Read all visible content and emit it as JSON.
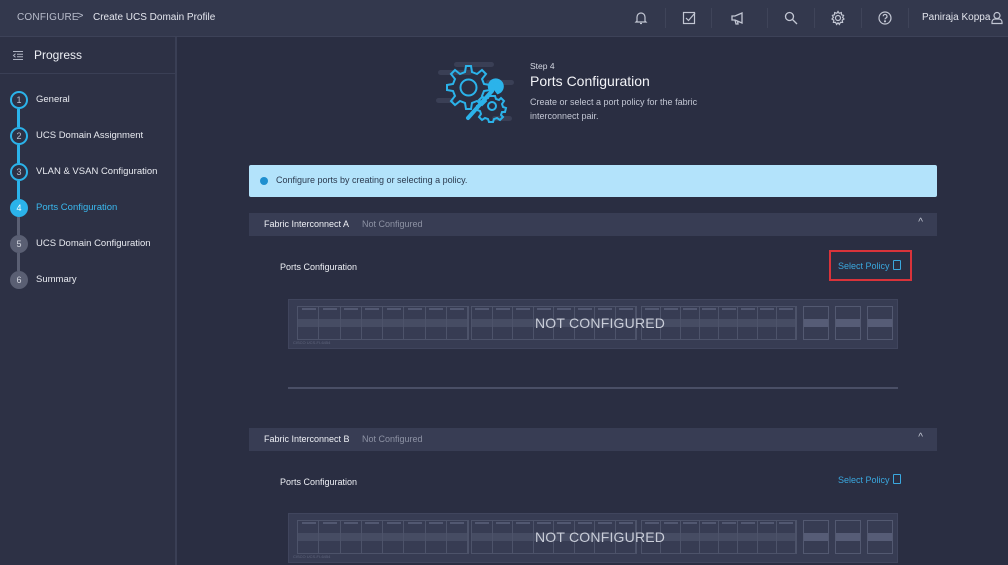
{
  "topbar": {
    "breadcrumb_root": "CONFIGURE",
    "breadcrumb_separator": ">",
    "breadcrumb_page": "Create UCS Domain Profile",
    "icons": [
      "bell-icon",
      "task-checklist-icon",
      "megaphone-icon",
      "search-icon",
      "gear-icon",
      "help-icon",
      "user-icon"
    ],
    "user_name": "Paniraja Koppa"
  },
  "sidebar": {
    "title": "Progress",
    "steps": [
      {
        "number": "1",
        "label": "General",
        "state": "done"
      },
      {
        "number": "2",
        "label": "UCS Domain Assignment",
        "state": "done"
      },
      {
        "number": "3",
        "label": "VLAN & VSAN Configuration",
        "state": "done"
      },
      {
        "number": "4",
        "label": "Ports Configuration",
        "state": "active"
      },
      {
        "number": "5",
        "label": "UCS Domain Configuration",
        "state": "pending"
      },
      {
        "number": "6",
        "label": "Summary",
        "state": "pending"
      }
    ]
  },
  "hero": {
    "step": "Step 4",
    "title": "Ports Configuration",
    "description": "Create or select a port policy for the fabric interconnect pair."
  },
  "info_banner": {
    "text": "Configure ports by creating or selecting a policy."
  },
  "fabric_interconnects": [
    {
      "name": "Fabric Interconnect A",
      "status": "Not Configured",
      "section_label": "Ports Configuration",
      "select_policy_label": "Select Policy",
      "overlay_text": "NOT CONFIGURED",
      "switch_model": "CISCO UCS-FI-6454",
      "highlighted": true
    },
    {
      "name": "Fabric Interconnect B",
      "status": "Not Configured",
      "section_label": "Ports Configuration",
      "select_policy_label": "Select Policy",
      "overlay_text": "NOT CONFIGURED",
      "switch_model": "CISCO UCS-FI-6454",
      "highlighted": false
    }
  ],
  "colors": {
    "accent": "#2bb3ea",
    "link": "#3aa8df",
    "highlight": "#d9333a",
    "banner": "#b3e3fb"
  }
}
